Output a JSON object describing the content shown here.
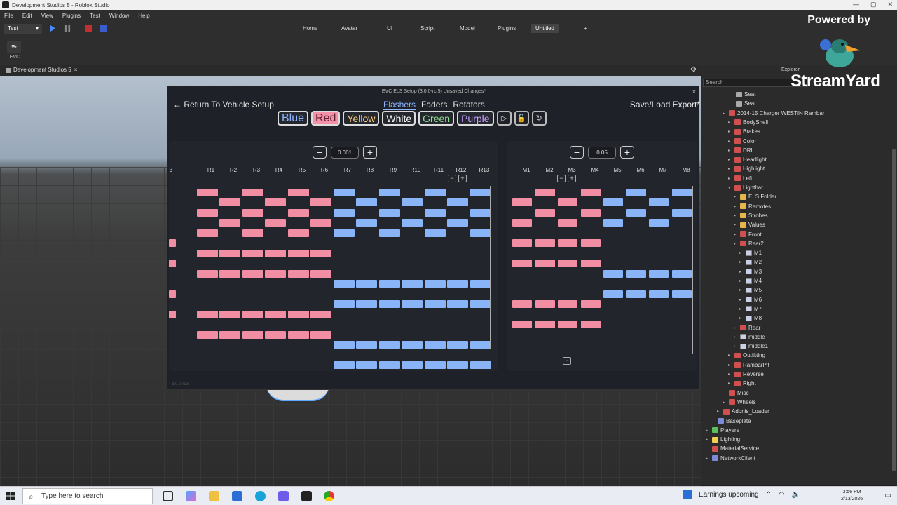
{
  "window": {
    "title": "Development Studios 5 - Roblox Studio"
  },
  "menu": [
    "File",
    "Edit",
    "View",
    "Plugins",
    "Test",
    "Window",
    "Help"
  ],
  "toolbar": {
    "mode": "Test",
    "tabs": [
      "Home",
      "Avatar",
      "UI",
      "Script",
      "Model",
      "Plugins",
      "Untitled",
      "+"
    ],
    "active_tab": "Untitled"
  },
  "ribbon": {
    "evc_label": "EVC"
  },
  "doc_tab": {
    "label": "Development Studios 5",
    "close": "×"
  },
  "panel": {
    "title": "EVC ELS Setup (3.0.0-rc.5) Unsaved Changes*",
    "close": "×",
    "back": "← Return To Vehicle Setup",
    "modes": [
      "Flashers",
      "Faders",
      "Rotators"
    ],
    "active_mode": "Flashers",
    "save_load": "Save/Load Export*",
    "colors": [
      "Blue",
      "Red",
      "Yellow",
      "White",
      "Green",
      "Purple"
    ],
    "active_color": "Red",
    "version": "3.0.0-rc.5"
  },
  "grid_left": {
    "step_value": "0.001",
    "partial_header": "3",
    "columns": [
      "R1",
      "R2",
      "R3",
      "R4",
      "R5",
      "R6",
      "R7",
      "R8",
      "R9",
      "R10",
      "R11",
      "R12",
      "R13"
    ]
  },
  "grid_right": {
    "step_value": "0.05",
    "columns": [
      "M1",
      "M2",
      "M3",
      "M4",
      "M5",
      "M6",
      "M7",
      "M8"
    ]
  },
  "explorer": {
    "title": "Explorer",
    "search_placeholder": "Search",
    "items": [
      {
        "label": "Seat",
        "icon": "seat"
      },
      {
        "label": "Seat",
        "icon": "seat"
      },
      {
        "label": "2014-15 Charger WESTIN Rambar",
        "icon": "car"
      },
      {
        "label": "BodyShell",
        "icon": "car"
      },
      {
        "label": "Brakes",
        "icon": "car"
      },
      {
        "label": "Color",
        "icon": "car"
      },
      {
        "label": "DRL",
        "icon": "car"
      },
      {
        "label": "Headlight",
        "icon": "car"
      },
      {
        "label": "Highlight",
        "icon": "car"
      },
      {
        "label": "Left",
        "icon": "car"
      },
      {
        "label": "Lightbar",
        "icon": "car"
      },
      {
        "label": "ELS Folder",
        "icon": "folder"
      },
      {
        "label": "Remotes",
        "icon": "folder"
      },
      {
        "label": "Strobes",
        "icon": "folder"
      },
      {
        "label": "Values",
        "icon": "folder"
      },
      {
        "label": "Front",
        "icon": "car"
      },
      {
        "label": "Rear2",
        "icon": "car"
      },
      {
        "label": "M1",
        "icon": "model"
      },
      {
        "label": "M2",
        "icon": "model"
      },
      {
        "label": "M3",
        "icon": "model"
      },
      {
        "label": "M4",
        "icon": "model"
      },
      {
        "label": "M5",
        "icon": "model"
      },
      {
        "label": "M6",
        "icon": "model"
      },
      {
        "label": "M7",
        "icon": "model"
      },
      {
        "label": "M8",
        "icon": "model"
      },
      {
        "label": "Rear",
        "icon": "car"
      },
      {
        "label": "middle",
        "icon": "model"
      },
      {
        "label": "middle1",
        "icon": "model"
      },
      {
        "label": "Outfitting",
        "icon": "car"
      },
      {
        "label": "RambarPlt",
        "icon": "car"
      },
      {
        "label": "Reverse",
        "icon": "car"
      },
      {
        "label": "Right",
        "icon": "car"
      },
      {
        "label": "Misc",
        "icon": "car"
      },
      {
        "label": "Wheels",
        "icon": "car"
      },
      {
        "label": "Adonis_Loader",
        "icon": "car"
      },
      {
        "label": "Baseplate",
        "icon": "part"
      },
      {
        "label": "Players",
        "icon": "player"
      },
      {
        "label": "Lighting",
        "icon": "light"
      },
      {
        "label": "MaterialService",
        "icon": "car"
      },
      {
        "label": "NetworkClient",
        "icon": "part"
      }
    ]
  },
  "overlay": {
    "powered_by": "Powered by",
    "brand": "StreamYard"
  },
  "taskbar": {
    "search_placeholder": "Type here to search",
    "weather": "Earnings upcoming",
    "time": "3:56 PM",
    "date": "2/13/2026"
  }
}
